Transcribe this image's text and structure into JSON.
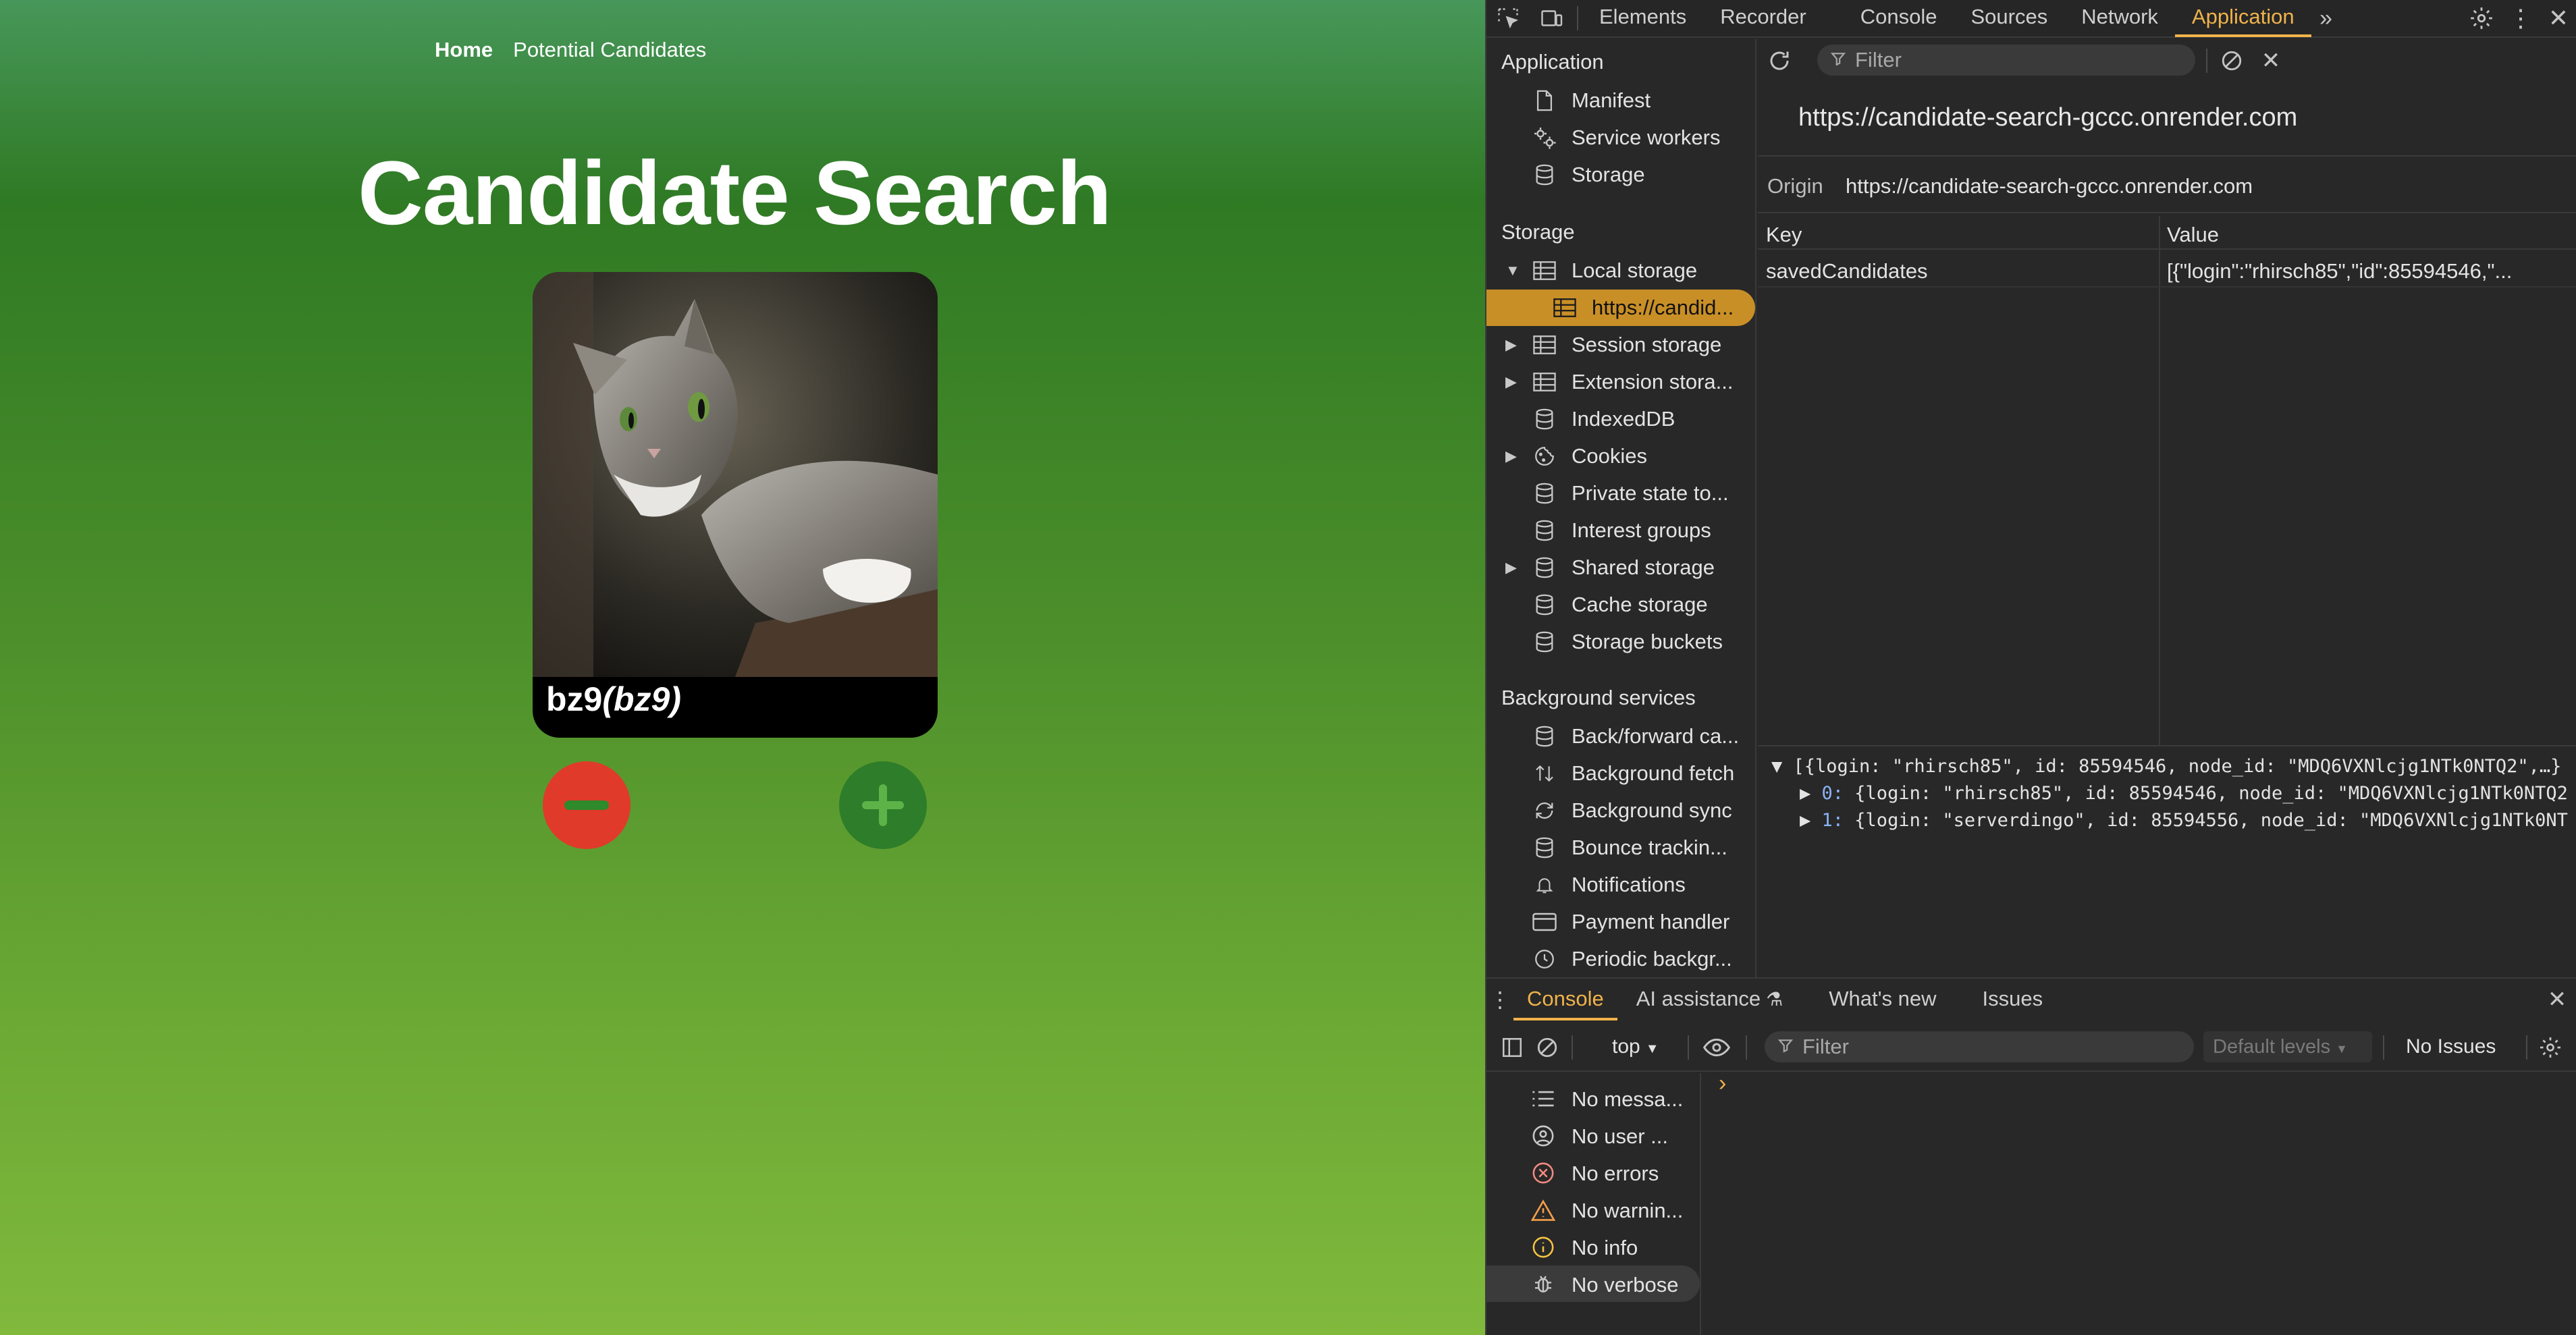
{
  "app": {
    "nav": {
      "home": "Home",
      "potential": "Potential Candidates"
    },
    "title": "Candidate Search",
    "candidate": {
      "login": "bz9",
      "name": "(bz9)"
    }
  },
  "devtools": {
    "tabs": [
      "Elements",
      "Recorder",
      "Console",
      "Sources",
      "Network",
      "Application"
    ],
    "active_tab": "Application",
    "sidebar": {
      "application_heading": "Application",
      "application_items": [
        "Manifest",
        "Service workers",
        "Storage"
      ],
      "storage_heading": "Storage",
      "storage_items": {
        "local": "Local storage",
        "local_origin": "https://candid...",
        "session": "Session storage",
        "extension": "Extension stora...",
        "indexeddb": "IndexedDB",
        "cookies": "Cookies",
        "private_state": "Private state to...",
        "interest": "Interest groups",
        "shared": "Shared storage",
        "cache": "Cache storage",
        "buckets": "Storage buckets"
      },
      "background_heading": "Background services",
      "background_items": {
        "bfcache": "Back/forward ca...",
        "bg_fetch": "Background fetch",
        "bg_sync": "Background sync",
        "bounce": "Bounce trackin...",
        "notifications": "Notifications",
        "payment": "Payment handler",
        "periodic": "Periodic backgr..."
      }
    },
    "storage_view": {
      "filter_placeholder": "Filter",
      "origin_url": "https://candidate-search-gccc.onrender.com",
      "origin_label": "Origin",
      "origin_value": "https://candidate-search-gccc.onrender.com",
      "columns": {
        "key": "Key",
        "value": "Value"
      },
      "rows": [
        {
          "key": "savedCandidates",
          "value": "[{\"login\":\"rhirsch85\",\"id\":85594546,\"..."
        }
      ],
      "preview": {
        "root": "[{login: \"rhirsch85\", id: 85594546, node_id: \"MDQ6VXNlcjg1NTk0NTQ2\",…}",
        "item0_index": "0",
        "item0": "{login: \"rhirsch85\", id: 85594546, node_id: \"MDQ6VXNlcjg1NTk0NTQ2",
        "item1_index": "1",
        "item1": "{login: \"serverdingo\", id: 85594556, node_id: \"MDQ6VXNlcjg1NTk0NT"
      }
    },
    "drawer": {
      "tabs": {
        "console": "Console",
        "ai": "AI assistance",
        "whats_new": "What's new",
        "issues": "Issues"
      },
      "context": "top",
      "filter_placeholder": "Filter",
      "levels": "Default levels",
      "issues_count": "No Issues",
      "prompt": "›",
      "sidebar": {
        "messages": "No messa...",
        "user": "No user ...",
        "errors": "No errors",
        "warnings": "No warnin...",
        "info": "No info",
        "verbose": "No verbose"
      }
    }
  }
}
